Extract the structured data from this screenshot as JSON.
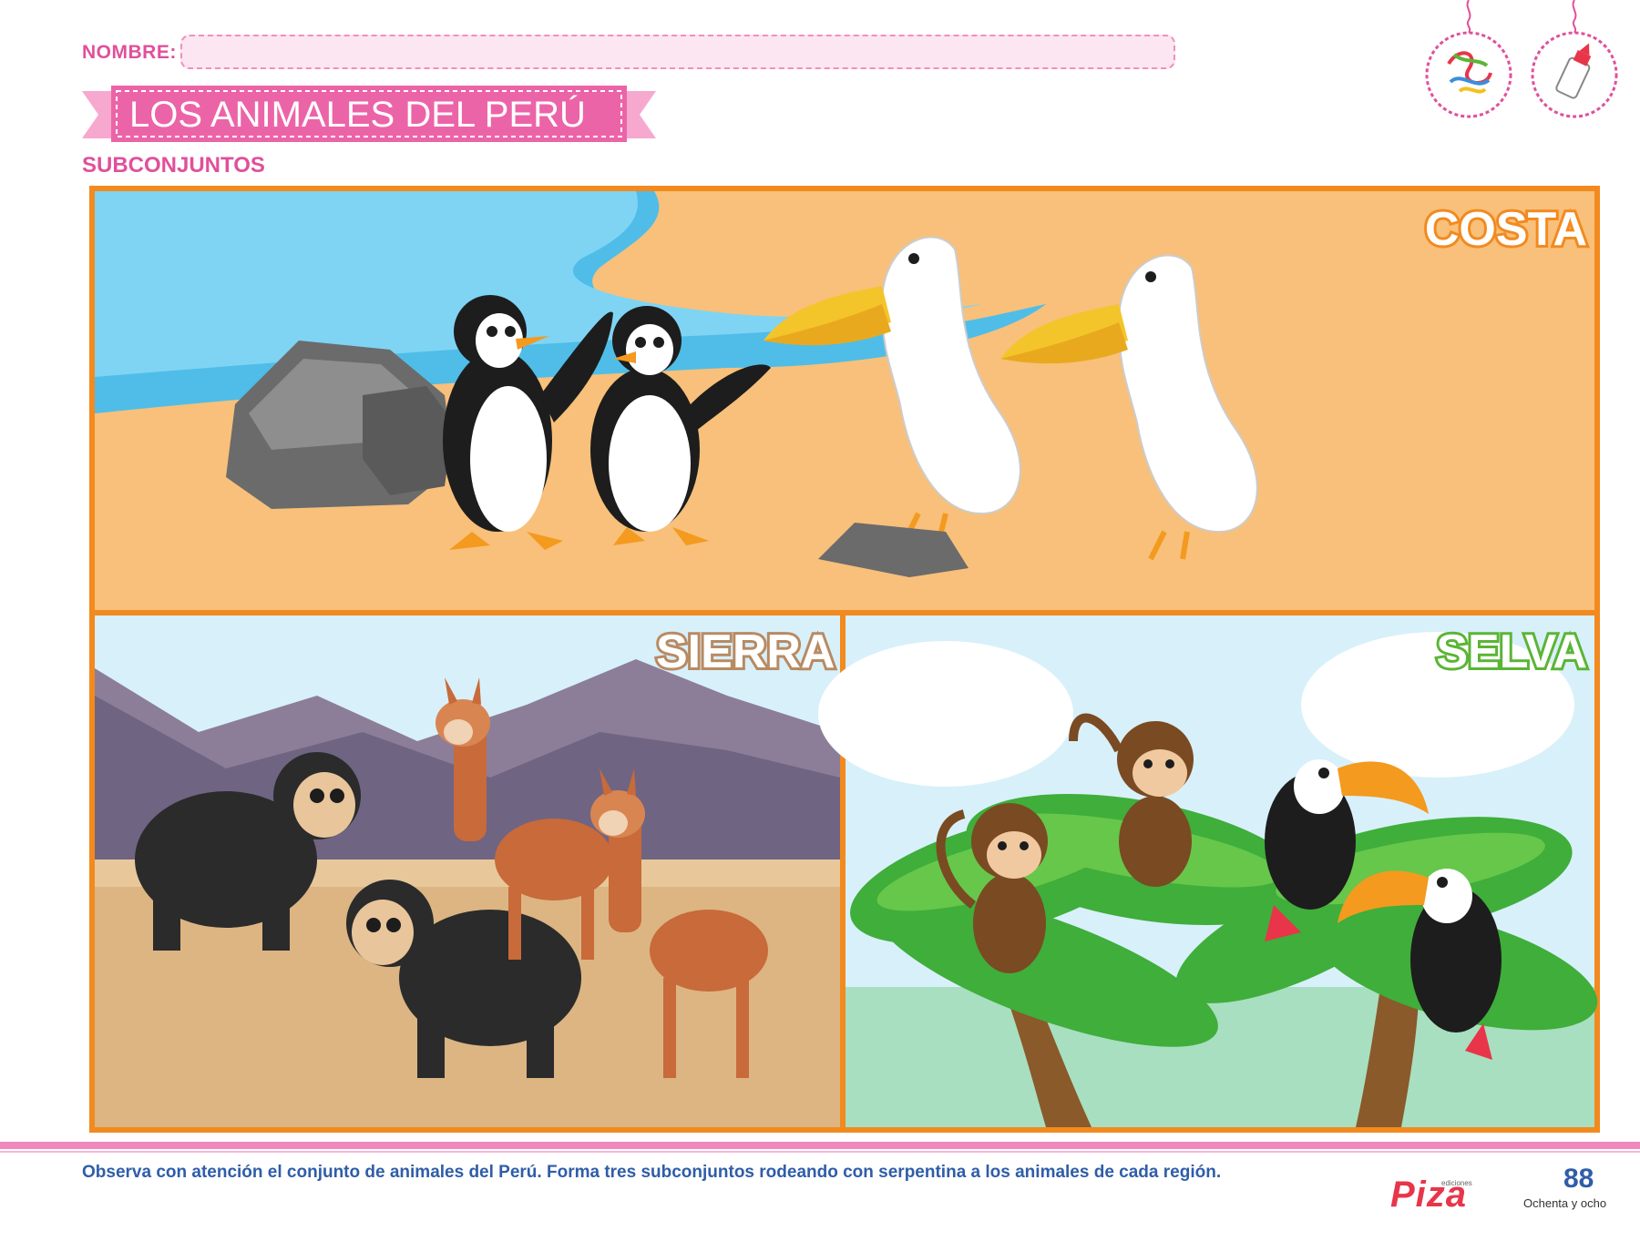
{
  "header": {
    "nombre_label": "NOMBRE:",
    "title": "LOS ANIMALES DEL PERÚ",
    "subtitle": "SUBCONJUNTOS"
  },
  "materials": {
    "icons": [
      "serpentina-icon",
      "goma-icon"
    ]
  },
  "regions": {
    "costa": {
      "label": "COSTA"
    },
    "sierra": {
      "label": "SIERRA"
    },
    "selva": {
      "label": "SELVA"
    }
  },
  "footer": {
    "instruction": "Observa con atención el conjunto de animales del Perú. Forma tres subconjuntos rodeando con serpentina a los animales de cada región.",
    "brand_small": "ediciones",
    "brand": "Piza",
    "page_number": "88",
    "page_words": "Ochenta y ocho"
  },
  "colors": {
    "accent_pink": "#e0509b",
    "frame_orange": "#f28a1f",
    "footer_blue": "#2f5da8"
  }
}
